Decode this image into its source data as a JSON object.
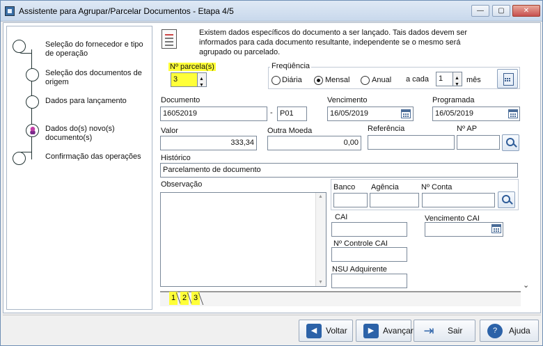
{
  "window": {
    "title": "Assistente para Agrupar/Parcelar Documentos - Etapa 4/5",
    "controls": {
      "minimize": "—",
      "maximize": "▢",
      "close": "✕"
    }
  },
  "steps": [
    {
      "label": "Seleção do fornecedor e tipo de operação",
      "state": "done"
    },
    {
      "label": "Seleção dos documentos de origem",
      "state": "done"
    },
    {
      "label": "Dados para lançamento",
      "state": "done"
    },
    {
      "label": "Dados do(s) novo(s) documento(s)",
      "state": "current"
    },
    {
      "label": "Confirmação das operações",
      "state": "pending"
    }
  ],
  "info": {
    "text": "Existem dados específicos do documento a ser lançado. Tais dados devem ser informados para cada documento resultante, independente se o mesmo será agrupado ou parcelado."
  },
  "parcelas": {
    "label": "Nº parcela(s)",
    "value": "3"
  },
  "frequencia": {
    "legend": "Freqüência",
    "options": [
      {
        "label": "Diária",
        "selected": false
      },
      {
        "label": "Mensal",
        "selected": true
      },
      {
        "label": "Anual",
        "selected": false
      }
    ],
    "a_cada_label": "a cada",
    "a_cada_value": "1",
    "unit": "mês"
  },
  "form": {
    "documento_label": "Documento",
    "documento_value": "16052019",
    "documento_sep": "-",
    "documento_suffix": "P01",
    "vencimento_label": "Vencimento",
    "vencimento_value": "16/05/2019",
    "programada_label": "Programada",
    "programada_value": "16/05/2019",
    "valor_label": "Valor",
    "valor_value": "333,34",
    "outra_moeda_label": "Outra Moeda",
    "outra_moeda_value": "0,00",
    "referencia_label": "Referência",
    "referencia_value": "",
    "nap_label": "Nº AP",
    "nap_value": "",
    "historico_label": "Histórico",
    "historico_value": "Parcelamento de documento",
    "observacao_label": "Observação",
    "banco_label": "Banco",
    "agencia_label": "Agência",
    "conta_label": "Nº Conta",
    "cai_label": "CAI",
    "venc_cai_label": "Vencimento CAI",
    "controle_cai_label": "Nº Controle CAI",
    "nsu_label": "NSU Adquirente"
  },
  "tabs": [
    "1",
    "2",
    "3"
  ],
  "footer": {
    "voltar": "Voltar",
    "avancar": "Avançar",
    "sair": "Sair",
    "ajuda": "Ajuda"
  },
  "colors": {
    "highlight": "#ffff38",
    "accent": "#2c62a8"
  }
}
